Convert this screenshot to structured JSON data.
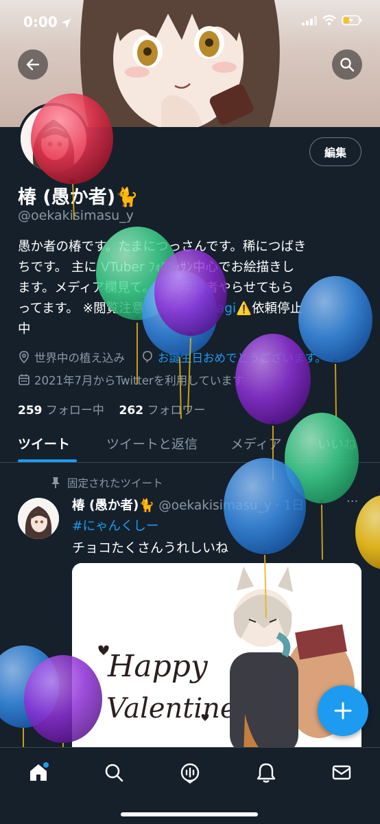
{
  "status_bar": {
    "time": "0:00"
  },
  "profile": {
    "edit_label": "編集",
    "display_name": "椿 (愚か者)🐈",
    "handle": "@oekakisimasu_y",
    "bio_line1": "愚か者の椿です。たまにつっさんです。稀につばき",
    "bio_line2": "ちです。 主に VTuber ﾌｫﾛﾜｯｻﾝ中心でお絵描きし",
    "bio_line3": "ます。メディア欄見て。受動喫煙者やらせてもら",
    "bio_line4a": "ってます。 ※閲覧注意",
    "bio_link": "@tsubaki_kagi",
    "bio_line4b": "⚠️依頼停止",
    "bio_line5": "中",
    "location": "世界中の植え込み",
    "birthday_text": "お誕生日おめでとうございます。",
    "joined": "2021年7月からTwitterを利用しています",
    "following_count": "259",
    "following_label": "フォロー中",
    "followers_count": "262",
    "followers_label": "フォロワー"
  },
  "tabs": [
    {
      "label": "ツイート"
    },
    {
      "label": "ツイートと返信"
    },
    {
      "label": "メディア"
    },
    {
      "label": "いいね"
    }
  ],
  "tweet": {
    "pinned_label": "固定されたツイート",
    "author": "椿 (愚か者)🐈",
    "meta": "@oekakisimasu_y · 1日",
    "more": "···",
    "hashtag": "#にゃんくしー",
    "text": "チョコたくさんうれしいね",
    "image_text_1": "Happy",
    "image_text_2": "Valentine"
  },
  "colors": {
    "background": "#15202b",
    "accent": "#1d9bf0",
    "muted": "#8b98a5",
    "balloon_red": "#e8324f",
    "balloon_green": "#3fd48e",
    "balloon_purple": "#8e2fd6",
    "balloon_blue": "#3b8fe8",
    "balloon_yellow": "#f3c21b"
  },
  "icons": {
    "back": "arrow-left-icon",
    "search": "search-icon",
    "location": "location-pin-icon",
    "birthday": "balloon-icon",
    "calendar": "calendar-icon",
    "pin": "pin-icon",
    "compose": "plus-icon",
    "nav": [
      "home-icon",
      "search-icon",
      "spaces-icon",
      "bell-icon",
      "mail-icon"
    ]
  }
}
